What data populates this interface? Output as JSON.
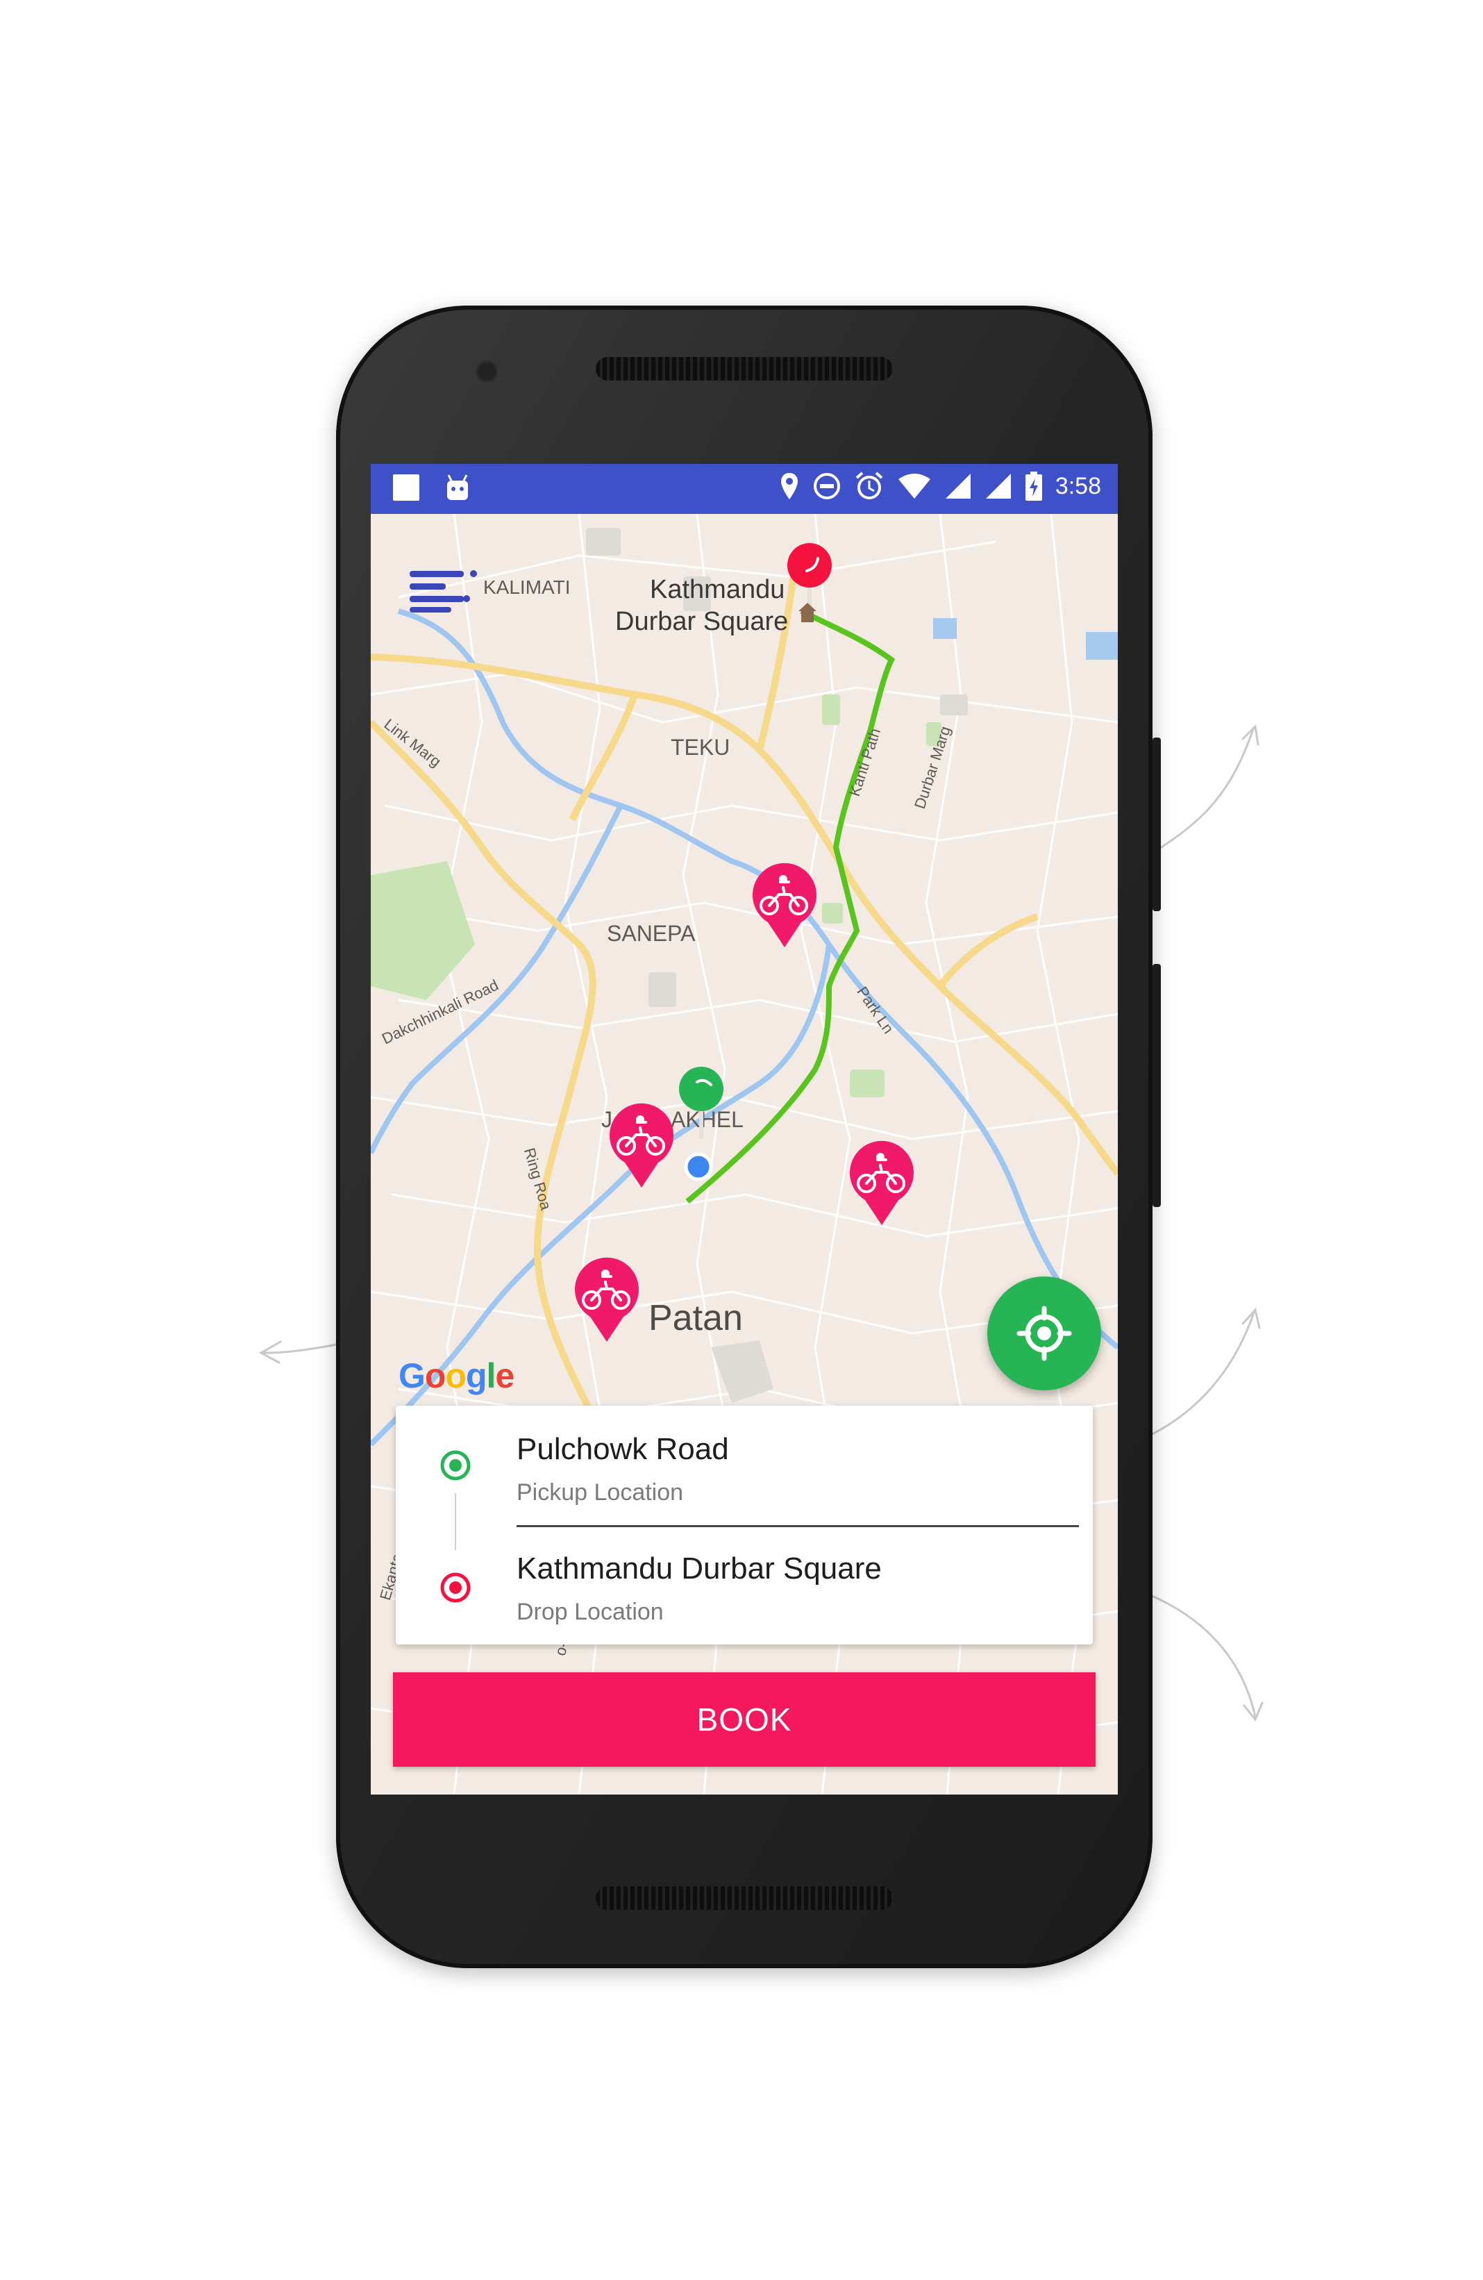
{
  "status_bar": {
    "time": "3:58",
    "left_icons": [
      "square-icon",
      "android-icon"
    ],
    "right_icons": [
      "location-icon",
      "do-not-disturb-icon",
      "alarm-icon",
      "wifi-icon",
      "signal-icon",
      "signal-icon-2",
      "battery-charging-icon"
    ]
  },
  "map": {
    "labels": {
      "kalimati": "KALIMATI",
      "kathmandu_durbar_1": "Kathmandu",
      "kathmandu_durbar_2": "Durbar Square",
      "teku": "TEKU",
      "sanepa": "SANEPA",
      "patan": "Patan",
      "jawalakhel": "AKHEL",
      "jawalakhel_prefix": "J",
      "link_marg": "Link Marg",
      "kanti_path": "Kanti Path",
      "durbar_marg": "Durbar Marg",
      "dakchhinkali": "Dakchhinkali Road",
      "ring_road": "Ring Roa",
      "park_ln": "Park Ln",
      "ekanta": "Ekanta",
      "tikidevi": "o-Tik"
    },
    "google_logo": [
      "G",
      "o",
      "o",
      "g",
      "l",
      "e"
    ],
    "colors": {
      "route": "#5ac41e",
      "pin_red": "#f5123e",
      "pin_green": "#27b455",
      "bike_pin": "#f0196a",
      "user_dot": "#3b86f0"
    }
  },
  "locations": {
    "pickup": {
      "title": "Pulchowk Road",
      "subtitle": "Pickup Location"
    },
    "drop": {
      "title": "Kathmandu Durbar Square",
      "subtitle": "Drop Location"
    }
  },
  "actions": {
    "book": "BOOK"
  },
  "colors": {
    "status_bar": "#3f51c8",
    "book_button": "#f5185f",
    "fab": "#27b455"
  }
}
